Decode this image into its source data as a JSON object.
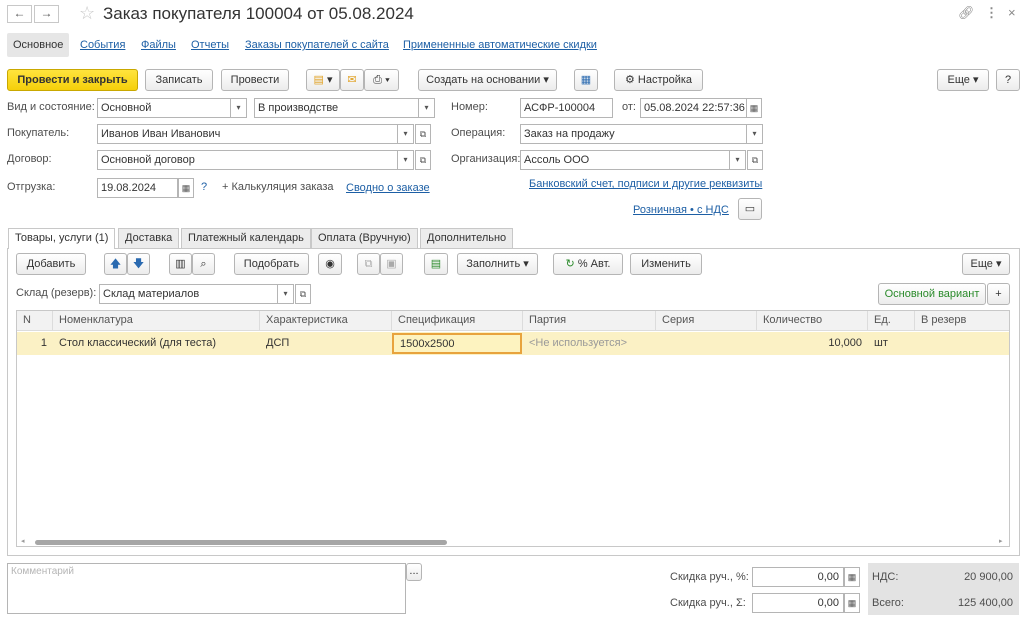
{
  "window": {
    "title": "Заказ покупателя 100004 от 05.08.2024",
    "back_glyph": "←",
    "forward_glyph": "→",
    "link_glyph": "🔗",
    "menu_glyph": "⋮",
    "close_glyph": "×"
  },
  "top_tabs": [
    "Основное",
    "События",
    "Файлы",
    "Отчеты",
    "Заказы покупателей с сайта",
    "Примененные автоматические скидки"
  ],
  "toolbar": {
    "post_close": "Провести и закрыть",
    "save": "Записать",
    "post": "Провести",
    "create_based": "Создать на основании",
    "settings": "Настройка",
    "more": "Еще",
    "help": "?"
  },
  "header": {
    "kind_label": "Вид и состояние:",
    "kind_value": "Основной",
    "state_value": "В производстве",
    "number_label": "Номер:",
    "number_value": "АСФР-100004",
    "date_prefix": "от:",
    "date_value": "05.08.2024 22:57:36",
    "buyer_label": "Покупатель:",
    "buyer_value": "Иванов Иван Иванович",
    "operation_label": "Операция:",
    "operation_value": "Заказ на продажу",
    "contract_label": "Договор:",
    "contract_value": "Основной договор",
    "org_label": "Организация:",
    "org_value": "Ассоль ООО",
    "ship_label": "Отгрузка:",
    "ship_value": "19.08.2024",
    "question": "?",
    "calc": "+ Калькуляция заказа",
    "summary_link": "Сводно о заказе",
    "bank_link": "Банковский счет, подписи и другие реквизиты",
    "price_link": "Розничная • с НДС"
  },
  "doc_tabs": [
    "Товары, услуги (1)",
    "Доставка",
    "Платежный календарь",
    "Оплата (Вручную)",
    "Дополнительно"
  ],
  "table_toolbar": {
    "add": "Добавить",
    "pick": "Подобрать",
    "fill": "Заполнить",
    "auto_pct": "% Авт.",
    "change": "Изменить",
    "more": "Еще"
  },
  "warehouse": {
    "label": "Склад (резерв):",
    "value": "Склад материалов",
    "variant": "Основной вариант",
    "plus": "+"
  },
  "table": {
    "columns": [
      "N",
      "Номенклатура",
      "Характеристика",
      "Спецификация",
      "Партия",
      "Серия",
      "Количество",
      "Ед.",
      "В резерв"
    ],
    "rows": [
      [
        "1",
        "Стол классический (для теста)",
        "ДСП",
        "1500x2500",
        "<Не используется>",
        "",
        "10,000",
        "шт",
        ""
      ]
    ]
  },
  "footer": {
    "comment_placeholder": "Комментарий",
    "comment_btn": "...",
    "disc_pct_label": "Скидка руч., %:",
    "disc_pct_value": "0,00",
    "disc_sum_label": "Скидка руч., Σ:",
    "disc_sum_value": "0,00",
    "vat_label": "НДС:",
    "vat_value": "20 900,00",
    "total_label": "Всего:",
    "total_value": "125 400,00"
  },
  "colors": {
    "accent_yellow": "#f5cf0a",
    "link_blue": "#1d5fa5",
    "row_selected": "#fbf1c5",
    "cell_active_border": "#e8a33d",
    "green": "#2a8a2a"
  }
}
